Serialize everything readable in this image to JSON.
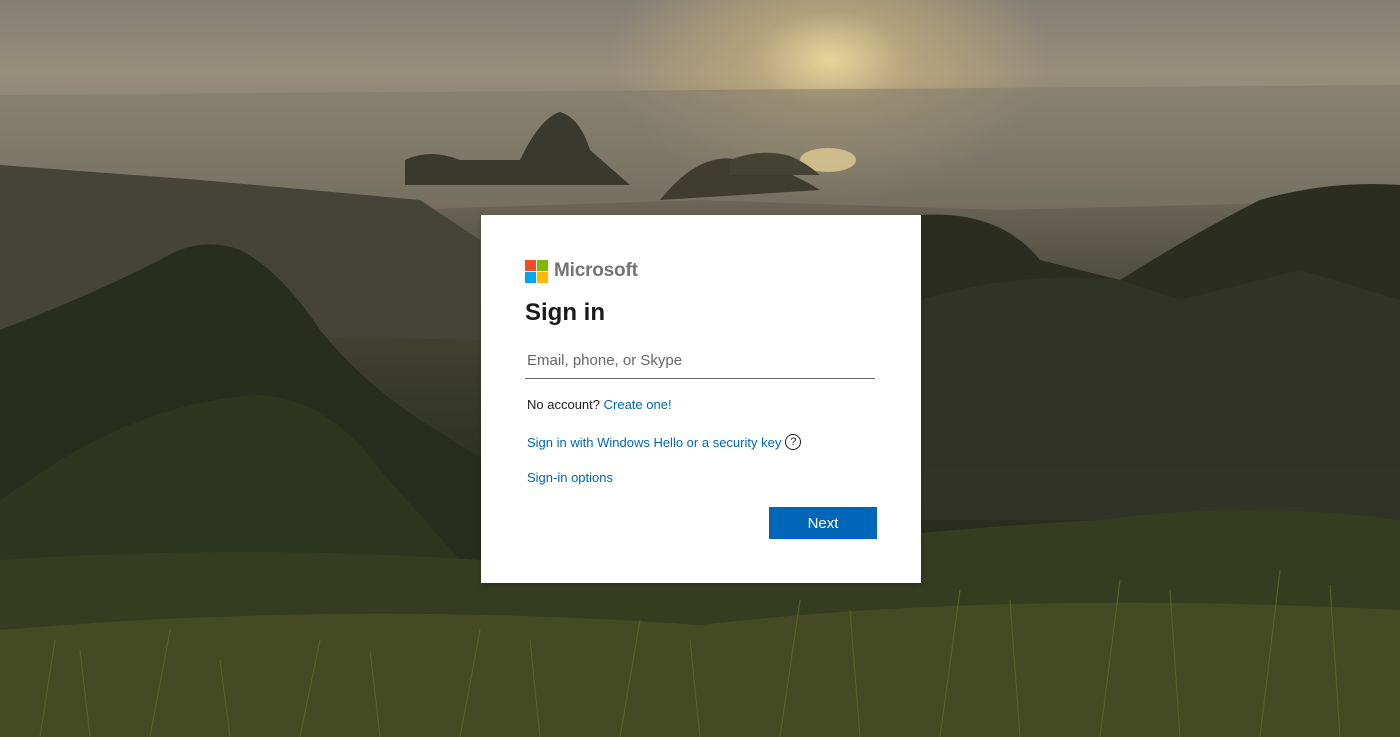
{
  "brand": {
    "name": "Microsoft",
    "logo_colors": [
      "#f25022",
      "#7fba00",
      "#00a4ef",
      "#ffb900"
    ]
  },
  "signin": {
    "title": "Sign in",
    "email_placeholder": "Email, phone, or Skype",
    "email_value": "",
    "no_account_text": "No account?",
    "create_link": "Create one!",
    "windows_hello_link": "Sign in with Windows Hello or a security key",
    "help_icon": "question-circle-icon",
    "help_glyph": "?",
    "options_link": "Sign-in options",
    "next_label": "Next"
  },
  "colors": {
    "accent": "#0067b8",
    "card_background": "#ffffff",
    "text": "#1b1b1b"
  }
}
